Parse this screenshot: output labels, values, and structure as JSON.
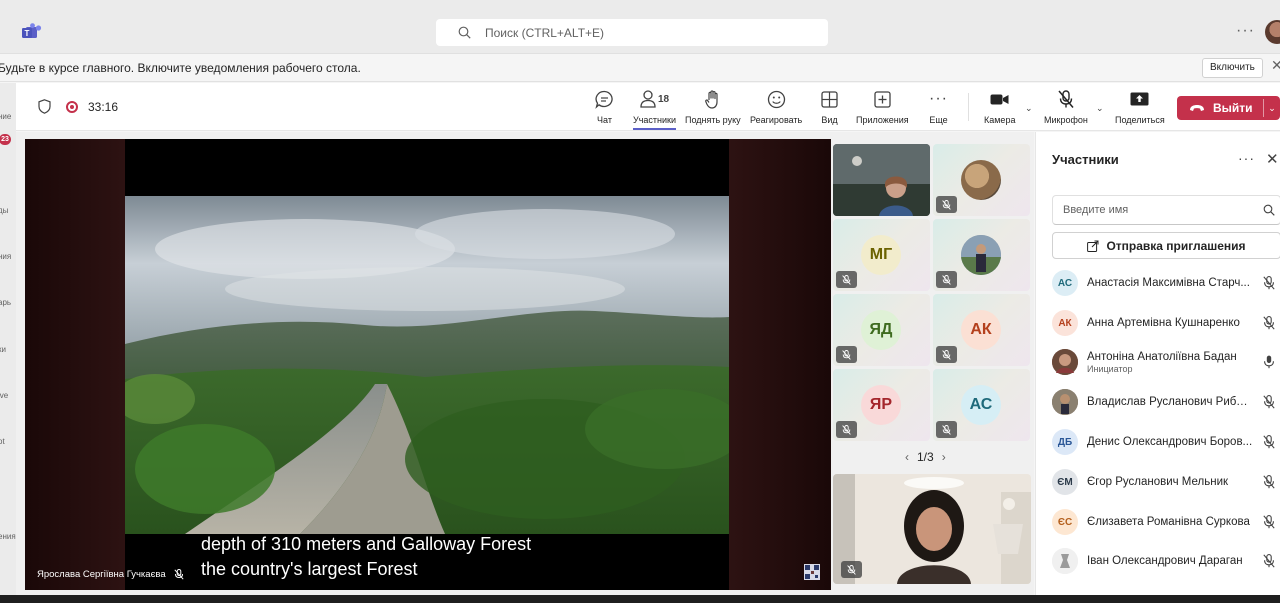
{
  "search": {
    "placeholder": "Поиск (CTRL+ALT+E)"
  },
  "notification": {
    "text": "Будьте в курсе главного. Включите уведомления рабочего стола.",
    "enable_label": "Включить"
  },
  "left_rail": {
    "labels": [
      "ние",
      "ды",
      "ния",
      "арь",
      "ки",
      "ive",
      "ot",
      "ения"
    ],
    "badge": "23"
  },
  "meeting": {
    "timer": "33:16",
    "toolbar": {
      "chat": "Чат",
      "participants": "Участники",
      "participants_count": "18",
      "raise_hand": "Поднять руку",
      "react": "Реагировать",
      "view": "Вид",
      "apps": "Приложения",
      "more": "Еще",
      "camera": "Камера",
      "mic": "Микрофон",
      "share": "Поделиться",
      "leave": "Выйти"
    }
  },
  "stage": {
    "caption_line1": "depth of 310 meters and Galloway Forest",
    "caption_line2": "the country's largest Forest",
    "presenter": "Ярослава Сергіївна Гучкаєва"
  },
  "tiles": [
    {
      "initials": "МГ",
      "color": "#6b6200"
    },
    {
      "initials": "ЯД",
      "color": "#3e6b1f"
    },
    {
      "initials": "АК",
      "color": "#b4401d"
    },
    {
      "initials": "ЯР",
      "color": "#a4262c"
    },
    {
      "initials": "АС",
      "color": "#1f6a7b"
    }
  ],
  "pager": {
    "label": "1/3"
  },
  "panel": {
    "title": "Участники",
    "search_placeholder": "Введите имя",
    "invite_label": "Отправка приглашения",
    "participants": [
      {
        "initials": "АС",
        "name": "Анастасія Максимівна Старч...",
        "role": "",
        "av_bg": "#dcedf5",
        "av_fg": "#1f6a7b"
      },
      {
        "initials": "АК",
        "name": "Анна Артемівна Кушнаренко",
        "role": "",
        "av_bg": "#fbe3da",
        "av_fg": "#b4401d"
      },
      {
        "initials": "",
        "name": "Антоніна Анатоліївна Бадан",
        "role": "Инициатор",
        "av_bg": "#7a4a3a",
        "av_fg": "#fff"
      },
      {
        "initials": "",
        "name": "Владислав Русланович Рибал...",
        "role": "",
        "av_bg": "#6d5a48",
        "av_fg": "#fff"
      },
      {
        "initials": "ДБ",
        "name": "Денис Олександрович Боров...",
        "role": "",
        "av_bg": "#dce8f7",
        "av_fg": "#2b5797"
      },
      {
        "initials": "ЄМ",
        "name": "Єгор Русланович Мельник",
        "role": "",
        "av_bg": "#e1e4e8",
        "av_fg": "#2b3a4a"
      },
      {
        "initials": "ЄС",
        "name": "Єлизавета Романівна Суркова",
        "role": "",
        "av_bg": "#fde7d2",
        "av_fg": "#b4601d"
      },
      {
        "initials": "",
        "name": "Іван Олександрович Дараган",
        "role": "",
        "av_bg": "#ececec",
        "av_fg": "#424242"
      }
    ]
  }
}
